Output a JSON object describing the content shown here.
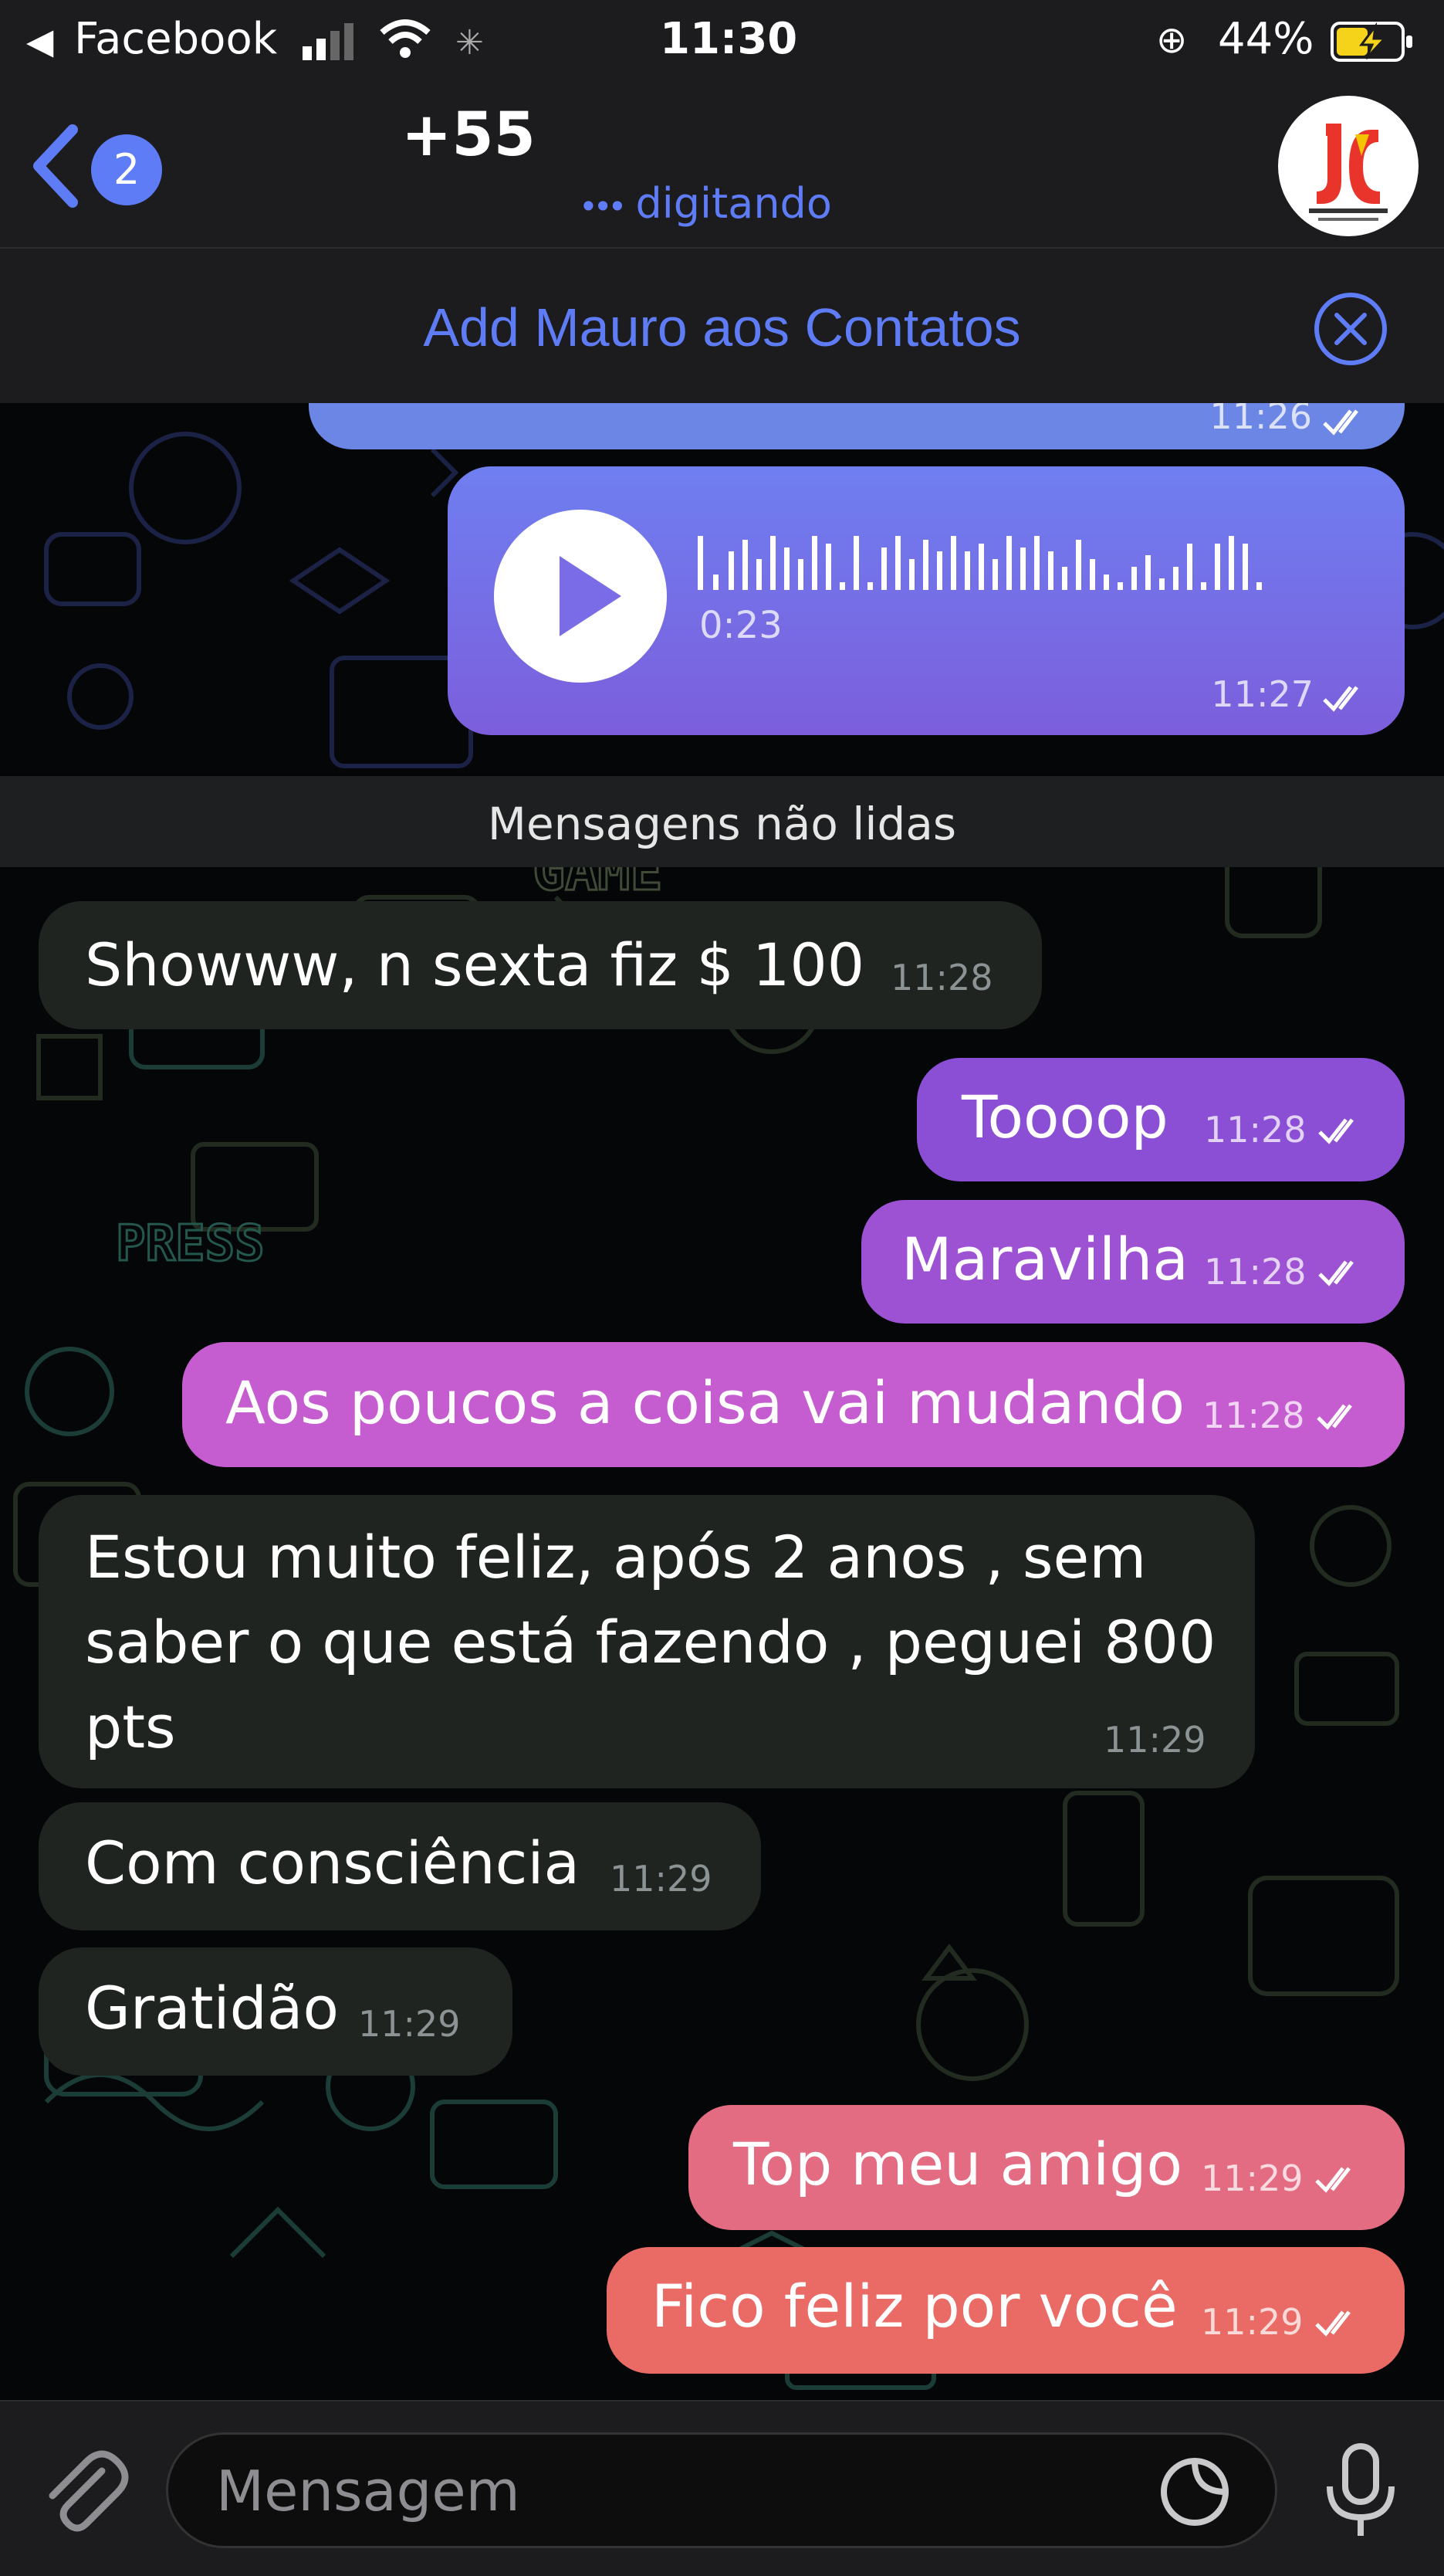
{
  "status_bar": {
    "back_app": "Facebook",
    "time": "11:30",
    "battery": "44%"
  },
  "header": {
    "back_count": "2",
    "title": "+55",
    "status": "digitando"
  },
  "banner": {
    "text": "Add Mauro aos Contatos"
  },
  "audio": {
    "duration": "0:23",
    "time": "11:27"
  },
  "partial_bubble_time": "11:26",
  "unread_label": "Mensagens não lidas",
  "messages": [
    {
      "dir": "in",
      "text": "Showww,  n sexta fiz $ 100",
      "time": "11:28"
    },
    {
      "dir": "out",
      "text": "Toooop",
      "time": "11:28"
    },
    {
      "dir": "out",
      "text": "Maravilha",
      "time": "11:28"
    },
    {
      "dir": "out",
      "text": "Aos poucos a coisa vai mudando",
      "time": "11:28"
    },
    {
      "dir": "in",
      "lines": [
        "Estou muito feliz,  após 2 anos , sem",
        "saber o que está fazendo , peguei 800",
        "pts"
      ],
      "time": "11:29"
    },
    {
      "dir": "in",
      "text": "Com consciência",
      "time": "11:29"
    },
    {
      "dir": "in",
      "text": "Gratidão",
      "time": "11:29"
    },
    {
      "dir": "out",
      "text": "Top meu amigo",
      "time": "11:29"
    },
    {
      "dir": "out",
      "text": "Fico feliz por você",
      "time": "11:29"
    }
  ],
  "input": {
    "placeholder": "Mensagem"
  },
  "colors": {
    "accent": "#5f7cf7",
    "out_purple": "#8b4fd6",
    "out_pink": "#d566c9",
    "out_coral": "#e9677a",
    "in_bubble": "#1f2420"
  }
}
